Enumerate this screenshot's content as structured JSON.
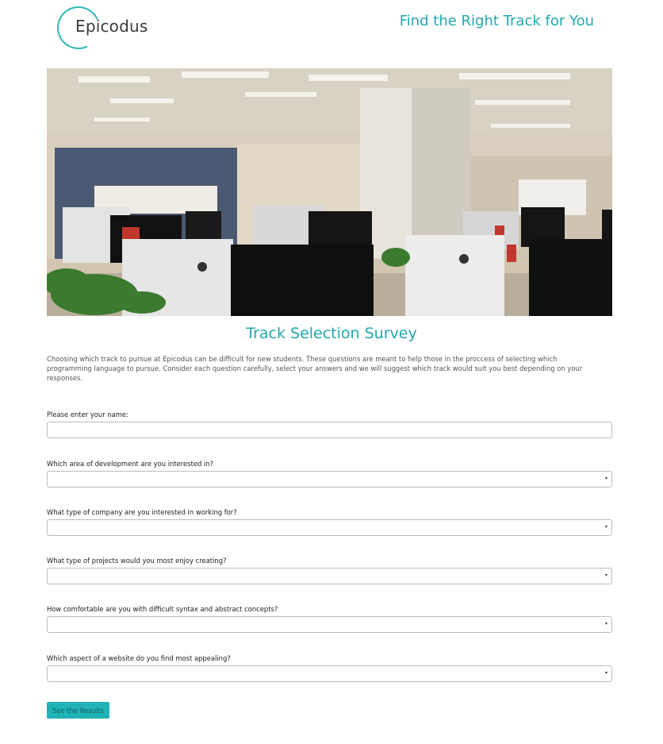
{
  "header": {
    "logo_text": "Epicodus",
    "tagline": "Find the Right Track for You"
  },
  "hero": {
    "image_desc": "office-workspace-photo"
  },
  "survey": {
    "title": "Track Selection Survey",
    "intro": "Choosing which track to pursue at Epicodus can be difficult for new students. These questions are meant to help those in the proccess of selecting which programming language to pursue. Consider each question carefully, select your answers and we will suggest which track would suit you best depending on your responses.",
    "name_label": "Please enter your name:",
    "name_value": "",
    "questions": [
      {
        "label": "Which area of development are you interested in?",
        "selected": ""
      },
      {
        "label": "What type of company are you interested in working for?",
        "selected": ""
      },
      {
        "label": "What type of projects would you most enjoy creating?",
        "selected": ""
      },
      {
        "label": "How comfortable are you with difficult syntax and abstract concepts?",
        "selected": ""
      },
      {
        "label": "Which aspect of a website do you find most appealing?",
        "selected": ""
      }
    ],
    "submit_label": "See the Results"
  },
  "colors": {
    "accent": "#20a9ae",
    "button": "#20b3b6"
  }
}
